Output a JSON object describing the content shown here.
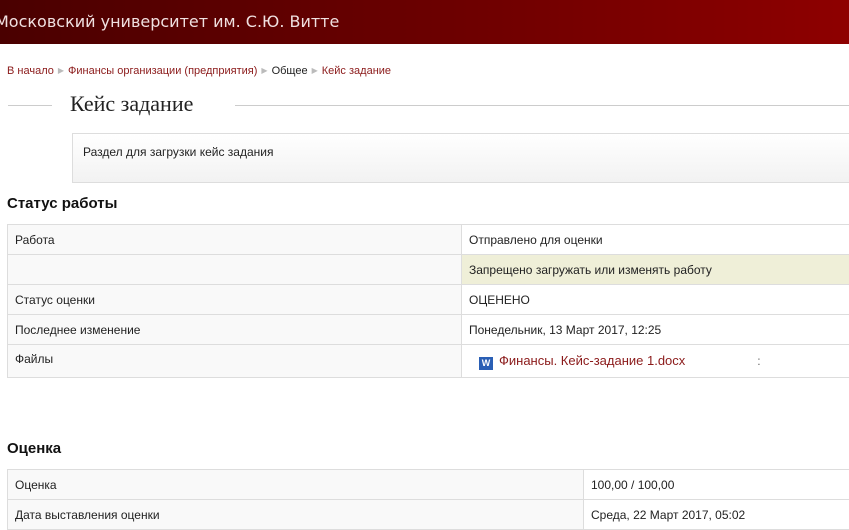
{
  "header": {
    "title": "Московский университет им. С.Ю. Витте"
  },
  "breadcrumb": [
    "В начало",
    "Финансы организации (предприятия)",
    "Общее",
    "Кейс задание"
  ],
  "page": {
    "title": "Кейс задание",
    "description": "Раздел для загрузки кейс задания"
  },
  "status": {
    "heading": "Статус работы",
    "rows": [
      {
        "label": "Работа",
        "value": "Отправлено для оценки"
      },
      {
        "label": "",
        "value": "Запрещено загружать или изменять работу"
      },
      {
        "label": "Статус оценки",
        "value": "ОЦЕНЕНО"
      },
      {
        "label": "Последнее изменение",
        "value": "Понедельник, 13 Март 2017, 12:25"
      },
      {
        "label": "Файлы",
        "file": "Финансы. Кейс-задание 1.docx",
        "extra": ":"
      }
    ]
  },
  "grade": {
    "heading": "Оценка",
    "rows": [
      {
        "label": "Оценка",
        "value": "100,00 / 100,00"
      },
      {
        "label": "Дата выставления оценки",
        "value": "Среда, 22 Март 2017, 05:02"
      }
    ]
  }
}
